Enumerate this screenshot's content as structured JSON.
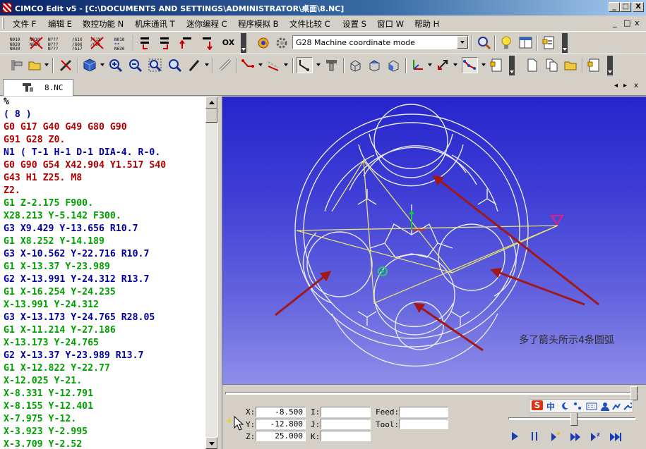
{
  "window": {
    "title": "CIMCO Edit v5 - [C:\\DOCUMENTS AND SETTINGS\\ADMINISTRATOR\\桌面\\8.NC]",
    "minimize": "_",
    "restore": "□",
    "close": "X"
  },
  "menubar": {
    "items": [
      "文件 F",
      "编辑 E",
      "数控功能 N",
      "机床通讯 T",
      "迷你编程 C",
      "程序模拟 B",
      "文件比较 C",
      "设置 S",
      "窗口 W",
      "帮助 H"
    ],
    "doc_minimize": "_",
    "doc_restore": "□",
    "doc_close": "x"
  },
  "toolbar": {
    "mode_combo_value": "G28 Machine coordinate mode",
    "ox_label": "OX"
  },
  "tab": {
    "label": "8.NC",
    "nav_left": "◂",
    "nav_right": "▸",
    "nav_close": "x"
  },
  "editor": {
    "lines": [
      {
        "text": "%",
        "color": "#000000"
      },
      {
        "text": "( 8 )",
        "color": "#0000a0"
      },
      {
        "text": "G0 G17 G40 G49 G80 G90",
        "color": "#b00000"
      },
      {
        "text": "G91 G28 Z0.",
        "color": "#b00000"
      },
      {
        "text": "N1 ( T-1 H-1 D-1 DIA-4. R-0.",
        "color": "#0000a0"
      },
      {
        "text": "G0 G90 G54 X42.904 Y1.517 S40",
        "color": "#b00000"
      },
      {
        "text": "G43 H1 Z25. M8",
        "color": "#b00000"
      },
      {
        "text": "Z2.",
        "color": "#b00000"
      },
      {
        "text": "G1 Z-2.175 F900.",
        "color": "#00a000"
      },
      {
        "text": "X28.213 Y-5.142 F300.",
        "color": "#00a000"
      },
      {
        "text": "G3 X9.429 Y-13.656 R10.7",
        "color": "#0000a0"
      },
      {
        "text": "G1 X8.252 Y-14.189",
        "color": "#00a000"
      },
      {
        "text": "G3 X-10.562 Y-22.716 R10.7",
        "color": "#0000a0"
      },
      {
        "text": "G1 X-13.37 Y-23.989",
        "color": "#00a000"
      },
      {
        "text": "G2 X-13.991 Y-24.312 R13.7",
        "color": "#0000a0"
      },
      {
        "text": "G1 X-16.254 Y-24.235",
        "color": "#00a000"
      },
      {
        "text": "X-13.991 Y-24.312",
        "color": "#00a000"
      },
      {
        "text": "G3 X-13.173 Y-24.765 R28.05",
        "color": "#0000a0"
      },
      {
        "text": "G1 X-11.214 Y-27.186",
        "color": "#00a000"
      },
      {
        "text": "X-13.173 Y-24.765",
        "color": "#00a000"
      },
      {
        "text": "G2 X-13.37 Y-23.989 R13.7",
        "color": "#0000a0"
      },
      {
        "text": "G1 X-12.822 Y-22.77",
        "color": "#00a000"
      },
      {
        "text": "X-12.025 Y-21.",
        "color": "#00a000"
      },
      {
        "text": "X-8.331 Y-12.791",
        "color": "#00a000"
      },
      {
        "text": "X-8.155 Y-12.401",
        "color": "#00a000"
      },
      {
        "text": "X-7.975 Y-12.",
        "color": "#00a000"
      },
      {
        "text": "X-3.923 Y-2.995",
        "color": "#00a000"
      },
      {
        "text": "X-3.709 Y-2.52",
        "color": "#00a000"
      }
    ]
  },
  "viewport": {
    "annotation": "多了箭头所示4条圆弧"
  },
  "coords": {
    "x_label": "X:",
    "x_value": "-8.500",
    "y_label": "Y:",
    "y_value": "-12.800",
    "z_label": "Z:",
    "z_value": "25.000",
    "i_label": "I:",
    "i_value": "",
    "j_label": "J:",
    "j_value": "",
    "k_label": "K:",
    "k_value": "",
    "feed_label": "Feed:",
    "feed_value": "",
    "tool_label": "Tool:",
    "tool_value": ""
  },
  "ime": {
    "brand": "S",
    "lang": "中"
  },
  "colors": {
    "titlebar_start": "#0a246a",
    "viewport_top": "#2525cc",
    "arrow": "#a01818",
    "toolpath_yellow": "#e8e070",
    "part_outline": "#e8e8f0"
  }
}
